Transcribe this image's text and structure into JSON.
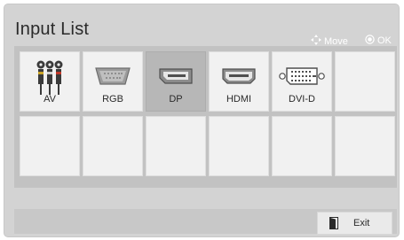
{
  "title": "Input List",
  "hints": {
    "move": "Move",
    "ok": "OK"
  },
  "inputs": [
    {
      "label": "AV",
      "icon": "av-rca-icon"
    },
    {
      "label": "RGB",
      "icon": "vga-port-icon"
    },
    {
      "label": "DP",
      "icon": "displayport-icon",
      "selected": true
    },
    {
      "label": "HDMI",
      "icon": "hdmi-port-icon"
    },
    {
      "label": "DVI-D",
      "icon": "dvi-port-icon"
    },
    {
      "label": "",
      "icon": ""
    }
  ],
  "exit_label": "Exit",
  "colors": {
    "panel": "#d3d3d3",
    "cell": "#f1f1f1",
    "selected_cell": "#b7b7b7"
  }
}
